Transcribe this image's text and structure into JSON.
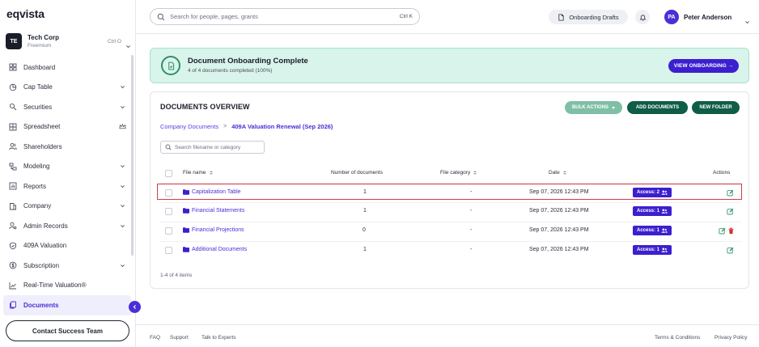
{
  "brand": {
    "logo_text": "eqvista"
  },
  "org": {
    "initials": "TE",
    "name": "Tech Corp",
    "plan": "Freemium",
    "shortcut": "Ctrl O"
  },
  "sidebar": {
    "items": [
      {
        "label": "Dashboard",
        "icon": "dashboard-icon",
        "expandable": false
      },
      {
        "label": "Cap Table",
        "icon": "pie-chart-icon",
        "expandable": true
      },
      {
        "label": "Securities",
        "icon": "securities-icon",
        "expandable": true
      },
      {
        "label": "Spreadsheet",
        "icon": "grid-icon",
        "expandable": false,
        "badge": "crown-icon"
      },
      {
        "label": "Shareholders",
        "icon": "users-icon",
        "expandable": false
      },
      {
        "label": "Modeling",
        "icon": "modeling-icon",
        "expandable": true
      },
      {
        "label": "Reports",
        "icon": "reports-icon",
        "expandable": true
      },
      {
        "label": "Company",
        "icon": "company-icon",
        "expandable": true
      },
      {
        "label": "Admin Records",
        "icon": "admin-icon",
        "expandable": true
      },
      {
        "label": "409A Valuation",
        "icon": "shield-icon",
        "expandable": false
      },
      {
        "label": "Subscription",
        "icon": "subscription-icon",
        "expandable": true
      },
      {
        "label": "Real-Time Valuation®",
        "icon": "trend-icon",
        "expandable": false
      },
      {
        "label": "Documents",
        "icon": "documents-icon",
        "expandable": false,
        "active": true
      }
    ],
    "contact_label": "Contact Success Team"
  },
  "topbar": {
    "search_placeholder": "Search for people, pages, grants",
    "search_shortcut": "Ctrl K",
    "drafts_label": "Onboarding Drafts",
    "user_initials": "PA",
    "user_name": "Peter Anderson"
  },
  "banner": {
    "title": "Document Onboarding Complete",
    "subtitle": "4 of 4 documents completed (100%)",
    "button_label": "VIEW ONBOARDING →"
  },
  "documents": {
    "title": "DOCUMENTS OVERVIEW",
    "bulk_label": "BULK ACTIONS",
    "add_label": "ADD DOCUMENTS",
    "new_folder_label": "NEW FOLDER",
    "breadcrumb_root": "Company Documents",
    "breadcrumb_separator": ">",
    "breadcrumb_current": "409A Valuation Renewal (Sep 2026)",
    "filter_placeholder": "Search filename or category",
    "columns": {
      "file_name": "File name",
      "count": "Number of documents",
      "category": "File category",
      "date": "Date",
      "actions": "Actions"
    },
    "rows": [
      {
        "name": "Capitalization Table",
        "count": "1",
        "category": "-",
        "date": "Sep 07, 2026 12:43 PM",
        "access": "Access: 2",
        "deletable": false
      },
      {
        "name": "Financial Statements",
        "count": "1",
        "category": "-",
        "date": "Sep 07, 2026 12:43 PM",
        "access": "Access: 1",
        "deletable": false
      },
      {
        "name": "Financial Projections",
        "count": "0",
        "category": "-",
        "date": "Sep 07, 2026 12:43 PM",
        "access": "Access: 1",
        "deletable": true
      },
      {
        "name": "Additional Documents",
        "count": "1",
        "category": "-",
        "date": "Sep 07, 2026 12:43 PM",
        "access": "Access: 1",
        "deletable": false
      }
    ],
    "items_count": "1-4 of 4 items"
  },
  "footer": {
    "faq": "FAQ",
    "support": "Support",
    "experts": "Talk to Experts",
    "terms": "Terms & Conditions",
    "privacy": "Privacy Policy"
  },
  "colors": {
    "accent": "#4b2ed6",
    "success_bg": "#d9f4ea",
    "dark_green": "#0f5d47",
    "highlight": "#d63a48"
  }
}
